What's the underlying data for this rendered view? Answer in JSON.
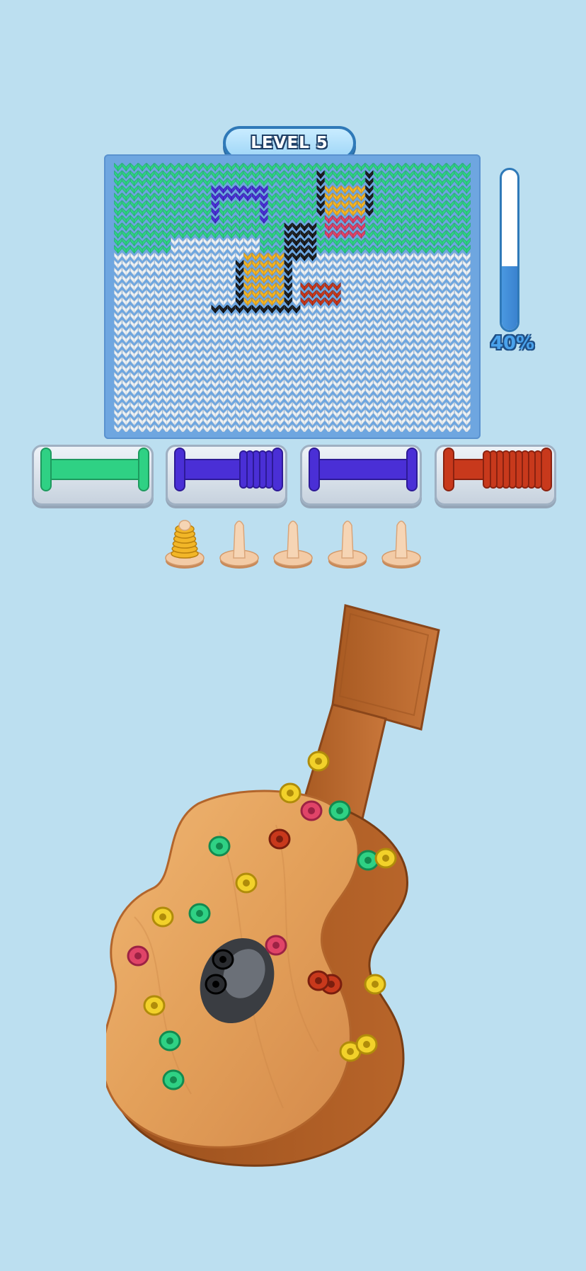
{
  "header": {
    "level_label": "LEVEL 5"
  },
  "progress": {
    "value": 0.4,
    "label": "40%"
  },
  "colors": {
    "background": "#bcdff0",
    "board_frame": "#6ea6e0",
    "green": "#2fd184",
    "white": "#e8eef2",
    "purple": "#4a2fd6",
    "black": "#1a1a1a",
    "yellow": "#f2b628",
    "pink": "#e04468",
    "red": "#c8391c",
    "wood": "#d48a44"
  },
  "spools": [
    {
      "color": "green",
      "coils": 0
    },
    {
      "color": "purple",
      "coils": 5
    },
    {
      "color": "purple",
      "coils": 0
    },
    {
      "color": "red",
      "coils": 9
    }
  ],
  "pegs": [
    {
      "filled": true,
      "color": "yellow"
    },
    {
      "filled": false
    },
    {
      "filled": false
    },
    {
      "filled": false
    },
    {
      "filled": false
    }
  ],
  "screws": [
    "green",
    "red",
    "yellow",
    "green",
    "yellow",
    "pink",
    "yellow",
    "green",
    "yellow",
    "green",
    "yellow",
    "pink",
    "pink",
    "green",
    "yellow",
    "green",
    "yellow",
    "red",
    "red",
    "yellow",
    "yellow",
    "black",
    "black"
  ]
}
